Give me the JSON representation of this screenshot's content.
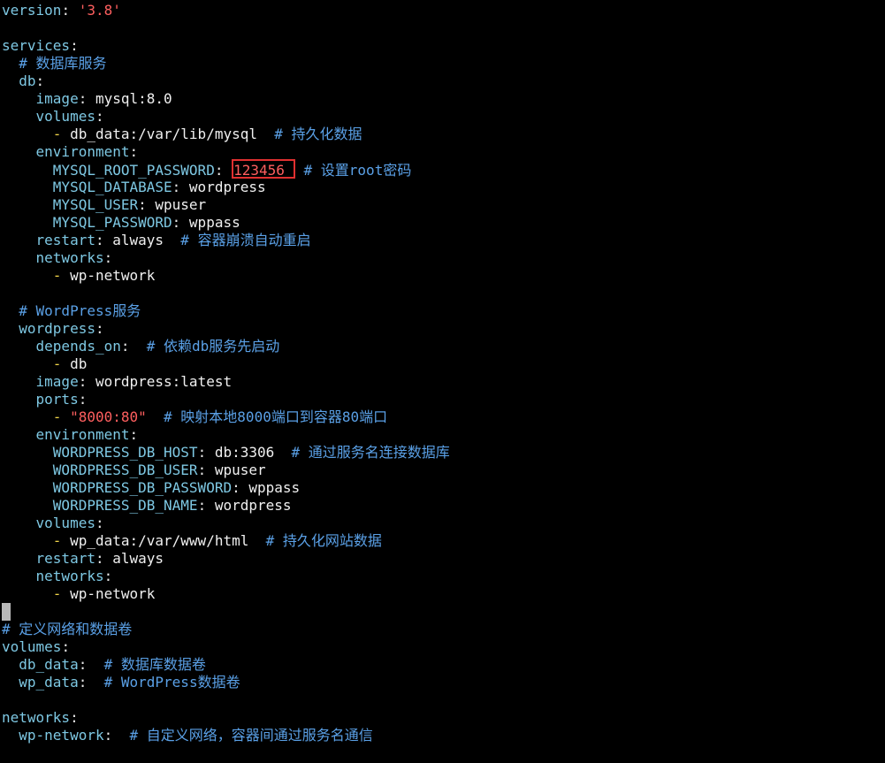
{
  "colors": {
    "background": "#000000",
    "key": "#7ec8e3",
    "punct": "#e6e6e6",
    "value": "#f0f0f0",
    "string": "#ff5f5f",
    "comment": "#5aa0e6",
    "dash": "#f1d54a",
    "highlight_box": "#e03030"
  },
  "lines": [
    [
      {
        "t": "version",
        "c": "key"
      },
      {
        "t": ": ",
        "c": "punct"
      },
      {
        "t": "'3.8'",
        "c": "string"
      }
    ],
    [],
    [
      {
        "t": "services",
        "c": "key"
      },
      {
        "t": ":",
        "c": "punct"
      }
    ],
    [
      {
        "t": "  # 数据库服务",
        "c": "comment"
      }
    ],
    [
      {
        "t": "  db",
        "c": "key"
      },
      {
        "t": ":",
        "c": "punct"
      }
    ],
    [
      {
        "t": "    image",
        "c": "key"
      },
      {
        "t": ": ",
        "c": "punct"
      },
      {
        "t": "mysql:8.0",
        "c": "value"
      }
    ],
    [
      {
        "t": "    volumes",
        "c": "key"
      },
      {
        "t": ":",
        "c": "punct"
      }
    ],
    [
      {
        "t": "      - ",
        "c": "dash"
      },
      {
        "t": "db_data:/var/lib/mysql",
        "c": "value"
      },
      {
        "t": "  # 持久化数据",
        "c": "comment"
      }
    ],
    [
      {
        "t": "    environment",
        "c": "key"
      },
      {
        "t": ":",
        "c": "punct"
      }
    ],
    [
      {
        "t": "      MYSQL_ROOT_PASSWORD",
        "c": "key"
      },
      {
        "t": ": ",
        "c": "punct"
      },
      {
        "t": "123456",
        "c": "string",
        "boxed": true
      },
      {
        "t": " # 设置root密码",
        "c": "comment"
      }
    ],
    [
      {
        "t": "      MYSQL_DATABASE",
        "c": "key"
      },
      {
        "t": ": ",
        "c": "punct"
      },
      {
        "t": "wordpress",
        "c": "value"
      }
    ],
    [
      {
        "t": "      MYSQL_USER",
        "c": "key"
      },
      {
        "t": ": ",
        "c": "punct"
      },
      {
        "t": "wpuser",
        "c": "value"
      }
    ],
    [
      {
        "t": "      MYSQL_PASSWORD",
        "c": "key"
      },
      {
        "t": ": ",
        "c": "punct"
      },
      {
        "t": "wppass",
        "c": "value"
      }
    ],
    [
      {
        "t": "    restart",
        "c": "key"
      },
      {
        "t": ": ",
        "c": "punct"
      },
      {
        "t": "always",
        "c": "value"
      },
      {
        "t": "  # 容器崩溃自动重启",
        "c": "comment"
      }
    ],
    [
      {
        "t": "    networks",
        "c": "key"
      },
      {
        "t": ":",
        "c": "punct"
      }
    ],
    [
      {
        "t": "      - ",
        "c": "dash"
      },
      {
        "t": "wp-network",
        "c": "value"
      }
    ],
    [],
    [
      {
        "t": "  # WordPress服务",
        "c": "comment"
      }
    ],
    [
      {
        "t": "  wordpress",
        "c": "key"
      },
      {
        "t": ":",
        "c": "punct"
      }
    ],
    [
      {
        "t": "    depends_on",
        "c": "key"
      },
      {
        "t": ":",
        "c": "punct"
      },
      {
        "t": "  # 依赖db服务先启动",
        "c": "comment"
      }
    ],
    [
      {
        "t": "      - ",
        "c": "dash"
      },
      {
        "t": "db",
        "c": "value"
      }
    ],
    [
      {
        "t": "    image",
        "c": "key"
      },
      {
        "t": ": ",
        "c": "punct"
      },
      {
        "t": "wordpress:latest",
        "c": "value"
      }
    ],
    [
      {
        "t": "    ports",
        "c": "key"
      },
      {
        "t": ":",
        "c": "punct"
      }
    ],
    [
      {
        "t": "      - ",
        "c": "dash"
      },
      {
        "t": "\"8000:80\"",
        "c": "string"
      },
      {
        "t": "  # 映射本地8000端口到容器80端口",
        "c": "comment"
      }
    ],
    [
      {
        "t": "    environment",
        "c": "key"
      },
      {
        "t": ":",
        "c": "punct"
      }
    ],
    [
      {
        "t": "      WORDPRESS_DB_HOST",
        "c": "key"
      },
      {
        "t": ": ",
        "c": "punct"
      },
      {
        "t": "db:3306",
        "c": "value"
      },
      {
        "t": "  # 通过服务名连接数据库",
        "c": "comment"
      }
    ],
    [
      {
        "t": "      WORDPRESS_DB_USER",
        "c": "key"
      },
      {
        "t": ": ",
        "c": "punct"
      },
      {
        "t": "wpuser",
        "c": "value"
      }
    ],
    [
      {
        "t": "      WORDPRESS_DB_PASSWORD",
        "c": "key"
      },
      {
        "t": ": ",
        "c": "punct"
      },
      {
        "t": "wppass",
        "c": "value"
      }
    ],
    [
      {
        "t": "      WORDPRESS_DB_NAME",
        "c": "key"
      },
      {
        "t": ": ",
        "c": "punct"
      },
      {
        "t": "wordpress",
        "c": "value"
      }
    ],
    [
      {
        "t": "    volumes",
        "c": "key"
      },
      {
        "t": ":",
        "c": "punct"
      }
    ],
    [
      {
        "t": "      - ",
        "c": "dash"
      },
      {
        "t": "wp_data:/var/www/html",
        "c": "value"
      },
      {
        "t": "  # 持久化网站数据",
        "c": "comment"
      }
    ],
    [
      {
        "t": "    restart",
        "c": "key"
      },
      {
        "t": ": ",
        "c": "punct"
      },
      {
        "t": "always",
        "c": "value"
      }
    ],
    [
      {
        "t": "    networks",
        "c": "key"
      },
      {
        "t": ":",
        "c": "punct"
      }
    ],
    [
      {
        "t": "      - ",
        "c": "dash"
      },
      {
        "t": "wp-network",
        "c": "value"
      }
    ],
    [],
    [
      {
        "t": "# 定义网络和数据卷",
        "c": "comment"
      }
    ],
    [
      {
        "t": "volumes",
        "c": "key"
      },
      {
        "t": ":",
        "c": "punct"
      }
    ],
    [
      {
        "t": "  db_data",
        "c": "key"
      },
      {
        "t": ":",
        "c": "punct"
      },
      {
        "t": "  # 数据库数据卷",
        "c": "comment"
      }
    ],
    [
      {
        "t": "  wp_data",
        "c": "key"
      },
      {
        "t": ":",
        "c": "punct"
      },
      {
        "t": "  # WordPress数据卷",
        "c": "comment"
      }
    ],
    [],
    [
      {
        "t": "networks",
        "c": "key"
      },
      {
        "t": ":",
        "c": "punct"
      }
    ],
    [
      {
        "t": "  wp-network",
        "c": "key"
      },
      {
        "t": ":",
        "c": "punct"
      },
      {
        "t": "  # 自定义网络，容器间通过服务名通信",
        "c": "comment"
      }
    ]
  ]
}
